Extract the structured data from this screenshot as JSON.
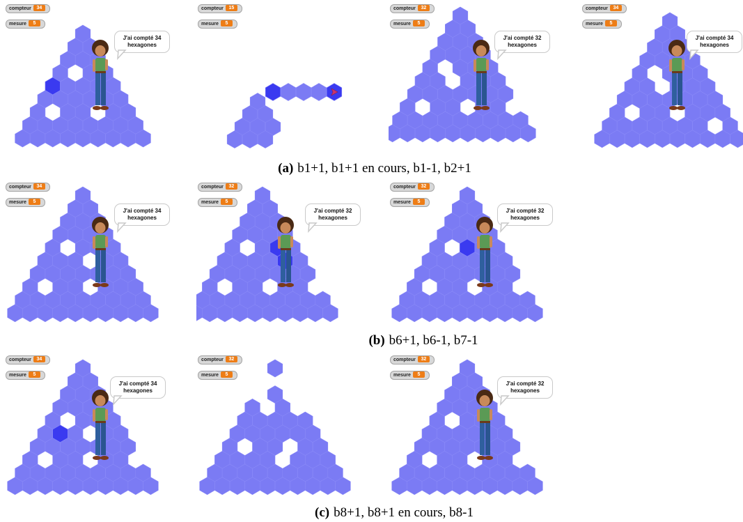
{
  "colors": {
    "hex_fill": "#7b7bf4",
    "hex_stroke": "#8a8af8",
    "highlight_fill": "#3a3af0",
    "watcher_value_bg": "#ee7d16"
  },
  "watcher_labels": {
    "counter": "compteur",
    "measure": "mesure"
  },
  "rows": [
    {
      "caption": {
        "label": "(a)",
        "text": "b1+1, b1+1 en cours, b1-1, b2+1"
      },
      "panels": [
        {
          "counter": "34",
          "measure": "5",
          "bubble": [
            "J'ai compté 34",
            "hexagones"
          ],
          "icon": "hexagon-triangle-with-character"
        },
        {
          "counter": "15",
          "measure": "5",
          "icon": "partial-hexagon-path-with-turtle"
        },
        {
          "counter": "32",
          "measure": "5",
          "bubble": [
            "J'ai compté 32",
            "hexagones"
          ],
          "icon": "hexagon-triangle-with-character"
        },
        {
          "counter": "34",
          "measure": "5",
          "bubble": [
            "J'ai compté 34",
            "hexagones"
          ],
          "icon": "hexagon-triangle-with-character"
        }
      ]
    },
    {
      "caption": {
        "label": "(b)",
        "text": "b6+1, b6-1, b7-1"
      },
      "panels": [
        {
          "counter": "34",
          "measure": "5",
          "bubble": [
            "J'ai compté 34",
            "hexagones"
          ],
          "icon": "hexagon-triangle-with-character"
        },
        {
          "counter": "32",
          "measure": "5",
          "bubble": [
            "J'ai compté 32",
            "hexagones"
          ],
          "icon": "hexagon-triangle-with-character"
        },
        {
          "counter": "32",
          "measure": "5",
          "bubble": [
            "J'ai compté 32",
            "hexagones"
          ],
          "icon": "hexagon-triangle-with-character"
        }
      ]
    },
    {
      "caption": {
        "label": "(c)",
        "text": "b8+1, b8+1 en cours, b8-1"
      },
      "panels": [
        {
          "counter": "34",
          "measure": "5",
          "bubble": [
            "J'ai compté 34",
            "hexagones"
          ],
          "icon": "hexagon-triangle-with-character"
        },
        {
          "counter": "32",
          "measure": "5",
          "icon": "hexagon-triangle-with-turtle"
        },
        {
          "counter": "32",
          "measure": "5",
          "bubble": [
            "J'ai compté 32",
            "hexagones"
          ],
          "icon": "hexagon-triangle-with-character"
        }
      ]
    }
  ]
}
